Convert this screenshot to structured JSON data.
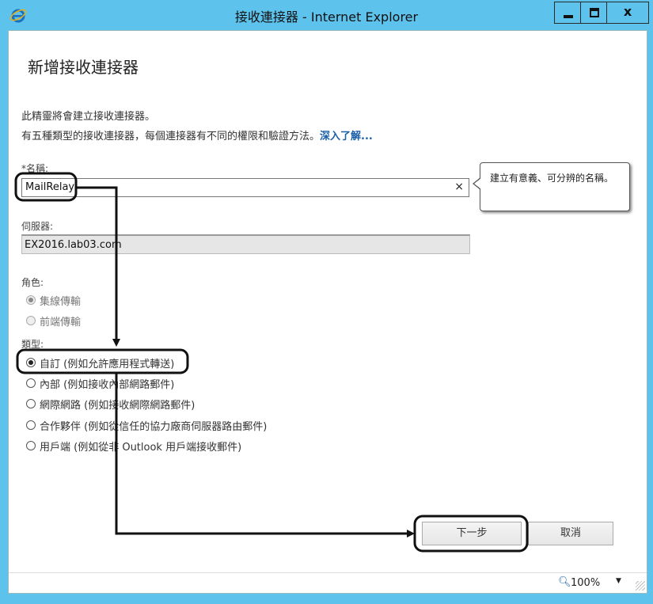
{
  "window": {
    "title": "接收連接器 - Internet Explorer",
    "minimize_icon": "minimize-icon",
    "maximize_icon": "maximize-icon",
    "close_label": "x",
    "accent": "#5dc2ec"
  },
  "page": {
    "title": "新增接收連接器",
    "intro_line1": "此精靈將會建立接收連接器。",
    "intro_line2": "有五種類型的接收連接器，每個連接器有不同的權限和驗證方法。",
    "learn_more_link": "深入了解..."
  },
  "name_field": {
    "label": "*名稱:",
    "value": "MailRelay",
    "clear_label": "×"
  },
  "tooltip": {
    "text": "建立有意義、可分辨的名稱。"
  },
  "server_field": {
    "label": "伺服器:",
    "value": "EX2016.lab03.com"
  },
  "role": {
    "label": "角色:",
    "options": [
      {
        "label": "集線傳輸",
        "selected": true,
        "disabled": true
      },
      {
        "label": "前端傳輸",
        "selected": false,
        "disabled": true
      }
    ]
  },
  "type": {
    "label": "類型:",
    "options": [
      {
        "label": "自訂 (例如允許應用程式轉送)",
        "selected": true
      },
      {
        "label": "內部 (例如接收內部網路郵件)",
        "selected": false
      },
      {
        "label": "網際網路 (例如接收網際網路郵件)",
        "selected": false
      },
      {
        "label": "合作夥伴 (例如從信任的協力廠商伺服器路由郵件)",
        "selected": false
      },
      {
        "label": "用戶端 (例如從非 Outlook 用戶端接收郵件)",
        "selected": false
      }
    ]
  },
  "buttons": {
    "next": "下一步",
    "cancel": "取消"
  },
  "statusbar": {
    "zoom": "100%",
    "zoom_icon": "zoom-magnifier-icon"
  }
}
